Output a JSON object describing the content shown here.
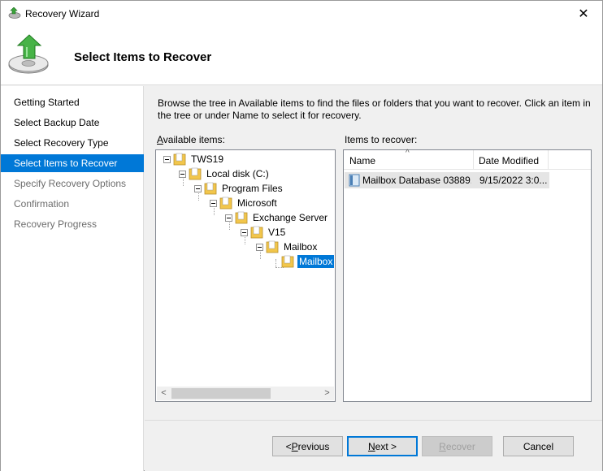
{
  "window": {
    "title": "Recovery Wizard",
    "close_glyph": "✕"
  },
  "header": {
    "title": "Select Items to Recover",
    "icon": "backup-recovery-icon"
  },
  "sidebar": {
    "steps": [
      {
        "label": "Getting Started",
        "state": "done"
      },
      {
        "label": "Select Backup Date",
        "state": "done"
      },
      {
        "label": "Select Recovery Type",
        "state": "done"
      },
      {
        "label": "Select Items to Recover",
        "state": "active"
      },
      {
        "label": "Specify Recovery Options",
        "state": "disabled"
      },
      {
        "label": "Confirmation",
        "state": "disabled"
      },
      {
        "label": "Recovery Progress",
        "state": "disabled"
      }
    ]
  },
  "content": {
    "instructions": "Browse the tree in Available items to find the files or folders that you want to recover. Click an item in the tree or under Name to select it for recovery.",
    "available_label_first": "A",
    "available_label_rest": "vailable items:",
    "recover_label": "Items to recover:"
  },
  "tree": {
    "nodes": [
      {
        "label": "TWS19"
      },
      {
        "label": "Local disk (C:)"
      },
      {
        "label": "Program Files"
      },
      {
        "label": "Microsoft"
      },
      {
        "label": "Exchange Server"
      },
      {
        "label": "V15"
      },
      {
        "label": "Mailbox"
      },
      {
        "label": "Mailbox",
        "selected": true
      }
    ],
    "scroll_left": "<",
    "scroll_right": ">"
  },
  "list": {
    "columns": [
      "Name",
      "Date Modified"
    ],
    "sort_glyph": "^",
    "rows": [
      {
        "name": "Mailbox Database 03889...",
        "date": "9/15/2022 3:0..."
      }
    ]
  },
  "buttons": {
    "previous": {
      "first": "< ",
      "accel": "P",
      "rest": "revious"
    },
    "next": {
      "accel": "N",
      "rest": "ext >"
    },
    "recover": {
      "accel": "R",
      "rest": "ecover"
    },
    "cancel": "Cancel"
  },
  "colors": {
    "accent": "#0078d7",
    "selection_row": "#e5e5e5",
    "folder": "#f2c64b"
  }
}
